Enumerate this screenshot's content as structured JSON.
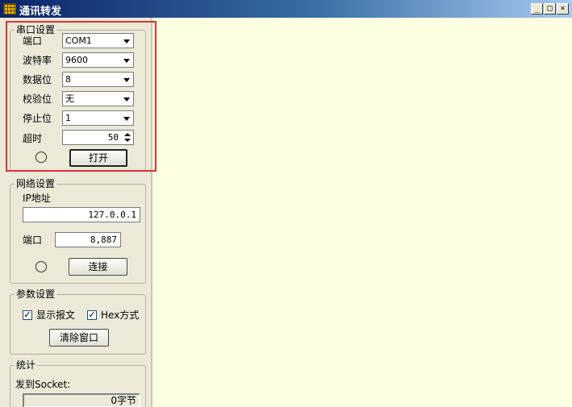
{
  "window": {
    "title": "通讯转发",
    "min_glyph": "_",
    "max_glyph": "□",
    "close_glyph": "×"
  },
  "serial": {
    "group_title": "串口设置",
    "port_label": "端口",
    "port_value": "COM1",
    "baud_label": "波特率",
    "baud_value": "9600",
    "databits_label": "数据位",
    "databits_value": "8",
    "parity_label": "校验位",
    "parity_value": "无",
    "stopbits_label": "停止位",
    "stopbits_value": "1",
    "timeout_label": "超时",
    "timeout_value": "50",
    "open_label": "打开"
  },
  "network": {
    "group_title": "网络设置",
    "ip_label": "IP地址",
    "ip_value": "127.0.0.1",
    "port_label": "端口",
    "port_value": "8,887",
    "connect_label": "连接"
  },
  "params": {
    "group_title": "参数设置",
    "show_msg_label": "显示报文",
    "show_msg_checked": true,
    "hex_label": "Hex方式",
    "hex_checked": true,
    "clear_label": "清除窗口"
  },
  "stats": {
    "group_title": "统计",
    "sent_label": "发到Socket:",
    "sent_value": "0字节"
  },
  "colors": {
    "log_background": "#ffffe1",
    "highlight": "#e0323a"
  }
}
